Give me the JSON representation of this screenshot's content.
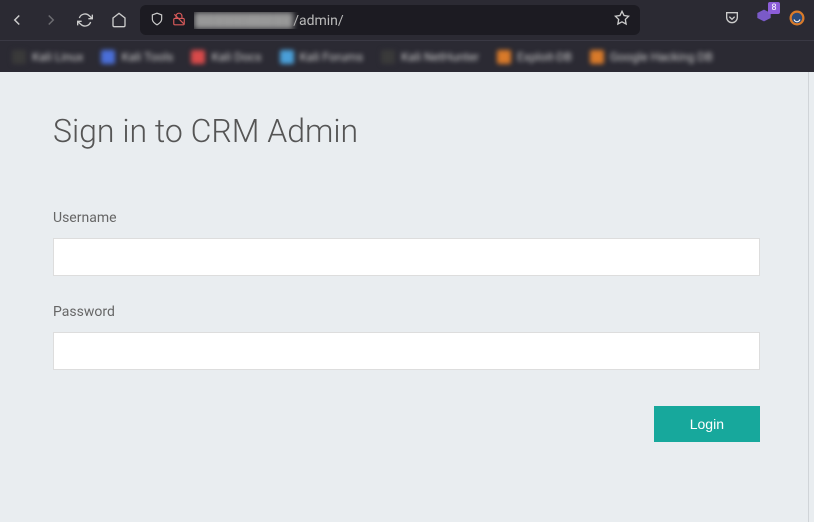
{
  "browser": {
    "url_visible": "/admin/",
    "notification_count": "8"
  },
  "bookmarks": [
    {
      "label": "Kali Linux",
      "color": "#3a3a3a"
    },
    {
      "label": "Kali Tools",
      "color": "#4a6fd8"
    },
    {
      "label": "Kali Docs",
      "color": "#d84a4a"
    },
    {
      "label": "Kali Forums",
      "color": "#4a9fd8"
    },
    {
      "label": "Kali NetHunter",
      "color": "#3a3a3a"
    },
    {
      "label": "Exploit-DB",
      "color": "#d87a2a"
    },
    {
      "label": "Google Hacking DB",
      "color": "#d87a2a"
    }
  ],
  "login": {
    "title": "Sign in to CRM Admin",
    "username_label": "Username",
    "password_label": "Password",
    "button_label": "Login"
  }
}
